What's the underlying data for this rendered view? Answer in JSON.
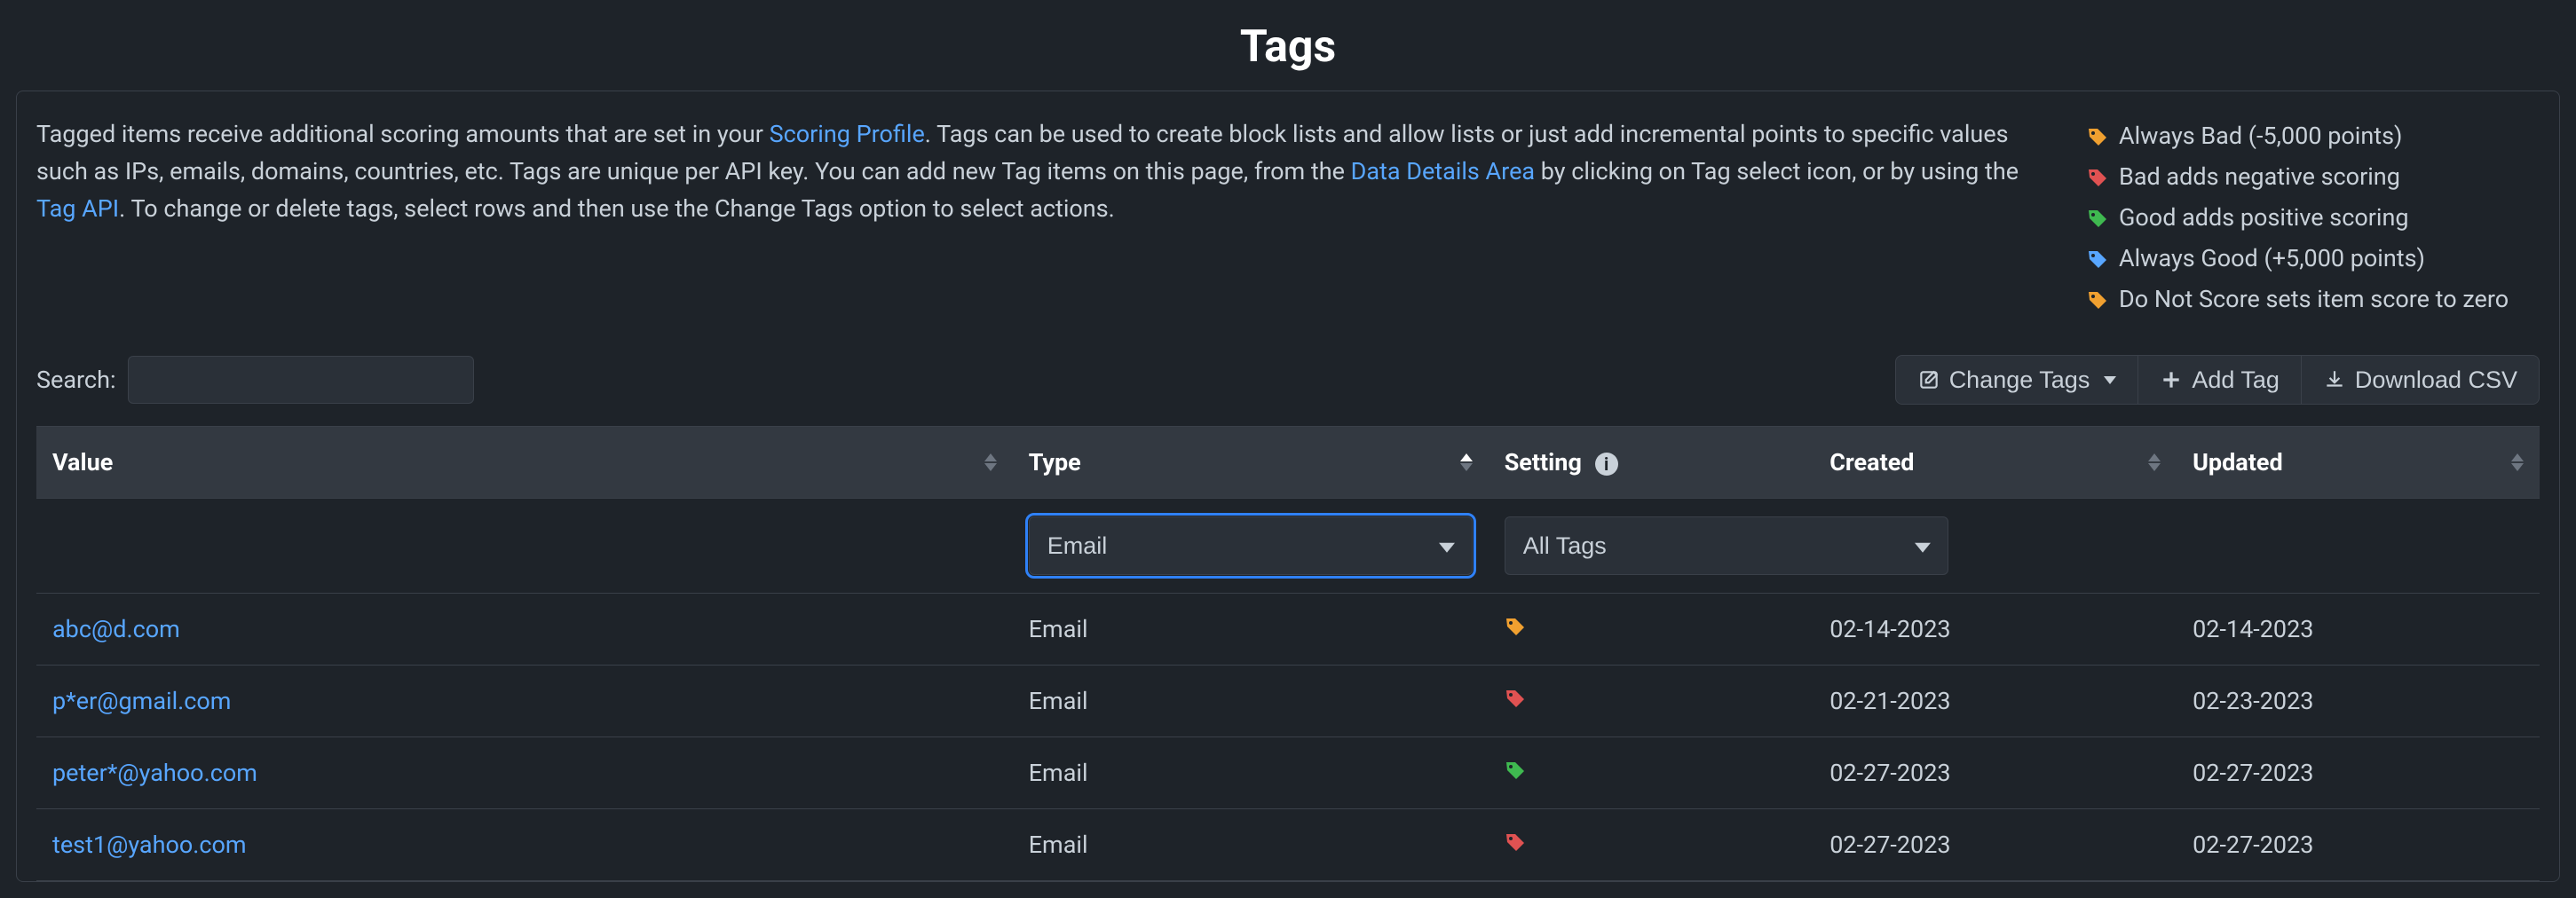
{
  "page_title": "Tags",
  "description": {
    "part1": "Tagged items receive additional scoring amounts that are set in your ",
    "link1": "Scoring Profile",
    "part2": ". Tags can be used to create block lists and allow lists or just add incremental points to specific values such as IPs, emails, domains, countries, etc. Tags are unique per API key. You can add new Tag items on this page, from the ",
    "link2": "Data Details Area",
    "part3": " by clicking on Tag select icon, or by using the ",
    "link3": "Tag API",
    "part4": ". To change or delete tags, select rows and then use the Change Tags option to select actions."
  },
  "legend": [
    {
      "color": "orange",
      "text": "Always Bad (-5,000 points)"
    },
    {
      "color": "red",
      "text": "Bad adds negative scoring"
    },
    {
      "color": "green",
      "text": "Good adds positive scoring"
    },
    {
      "color": "blue",
      "text": "Always Good (+5,000 points)"
    },
    {
      "color": "yellow",
      "text": "Do Not Score sets item score to zero"
    }
  ],
  "search_label": "Search:",
  "buttons": {
    "change_tags": "Change Tags",
    "add_tag": "Add Tag",
    "download_csv": "Download CSV"
  },
  "columns": {
    "value": "Value",
    "type": "Type",
    "setting": "Setting",
    "created": "Created",
    "updated": "Updated"
  },
  "filters": {
    "type_selected": "Email",
    "setting_selected": "All Tags"
  },
  "rows": [
    {
      "value": "abc@d.com",
      "type": "Email",
      "setting_color": "orange",
      "created": "02-14-2023",
      "updated": "02-14-2023"
    },
    {
      "value": "p*er@gmail.com",
      "type": "Email",
      "setting_color": "red",
      "created": "02-21-2023",
      "updated": "02-23-2023"
    },
    {
      "value": "peter*@yahoo.com",
      "type": "Email",
      "setting_color": "green",
      "created": "02-27-2023",
      "updated": "02-27-2023"
    },
    {
      "value": "test1@yahoo.com",
      "type": "Email",
      "setting_color": "red",
      "created": "02-27-2023",
      "updated": "02-27-2023"
    }
  ]
}
